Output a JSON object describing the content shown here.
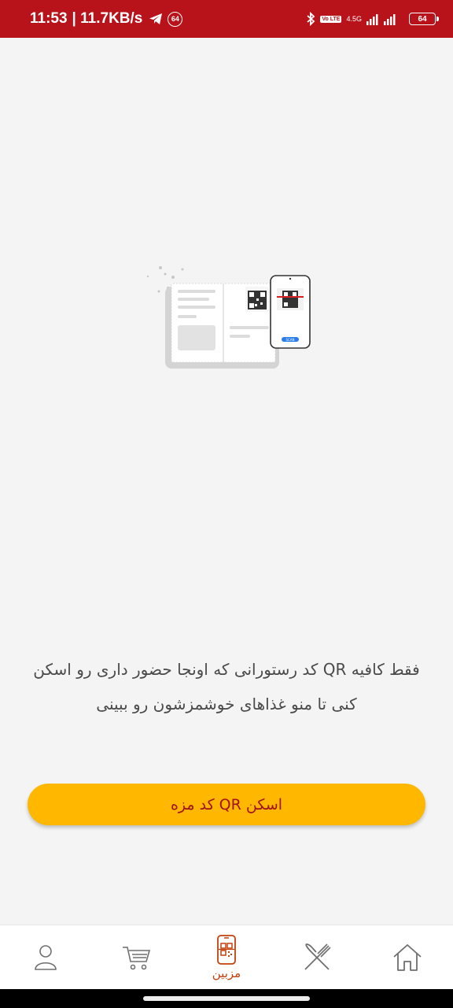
{
  "status_bar": {
    "time": "11:53",
    "network_speed": "| 11.7KB/s",
    "notification_badge": "64",
    "signal_type": "4.5G",
    "volte": "Vo LTE",
    "battery": "64"
  },
  "main": {
    "illustration_icon": "qr-menu-scan-illustration",
    "description": "فقط کافیه QR کد رستورانی که اونجا حضور داری رو اسکن کنی تا منو غذاهای خوشمزشون رو ببینی",
    "scan_button_label": "اسکن QR کد مزه",
    "illustration_button_label": "SCAN"
  },
  "bottom_nav": {
    "items": [
      {
        "icon": "profile-icon",
        "label": ""
      },
      {
        "icon": "cart-icon",
        "label": ""
      },
      {
        "icon": "qr-scan-icon",
        "label": "مزبین",
        "active": true
      },
      {
        "icon": "restaurant-utensils-icon",
        "label": ""
      },
      {
        "icon": "home-icon",
        "label": ""
      }
    ]
  },
  "colors": {
    "status_bar": "#b8121b",
    "accent": "#ffb700",
    "button_text": "#a3121a",
    "active_nav": "#c2410c",
    "background": "#f4f4f4"
  }
}
